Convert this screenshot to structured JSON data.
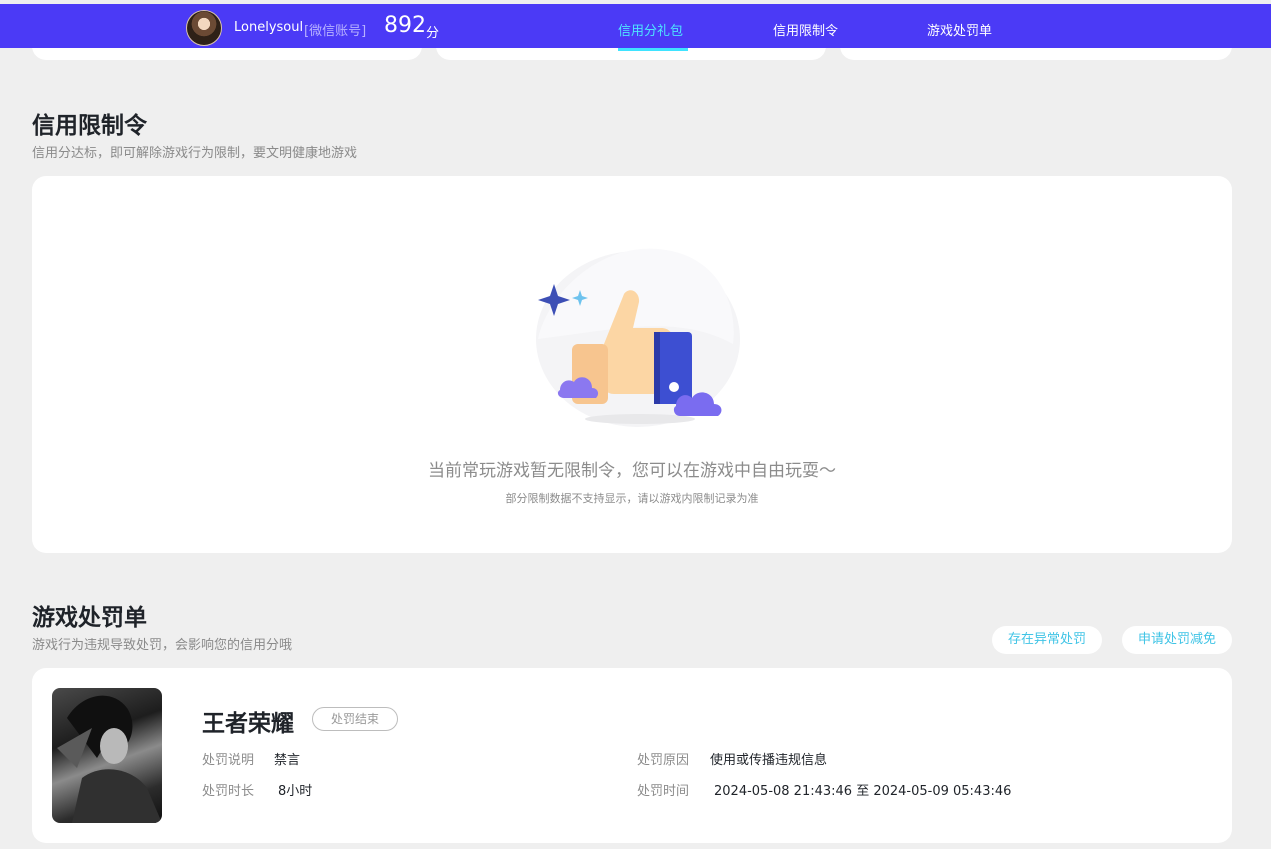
{
  "header": {
    "username": "Lonelysoul",
    "account_type": "[微信账号]",
    "score": "892",
    "score_unit": "分",
    "nav": [
      {
        "label": "信用分礼包",
        "active": true
      },
      {
        "label": "信用限制令",
        "active": false
      },
      {
        "label": "游戏处罚单",
        "active": false
      }
    ],
    "accent_color": "#4b3af6",
    "active_color": "#4fe6ff"
  },
  "restriction": {
    "title": "信用限制令",
    "subtitle": "信用分达标，即可解除游戏行为限制，要文明健康地游戏",
    "empty_message": "当前常玩游戏暂无限制令，您可以在游戏中自由玩耍～",
    "empty_note": "部分限制数据不支持显示，请以游戏内限制记录为准",
    "illustration_icon": "thumbs-up-icon"
  },
  "penalty": {
    "title": "游戏处罚单",
    "subtitle": "游戏行为违规导致处罚，会影响您的信用分哦",
    "actions": [
      "存在异常处罚",
      "申请处罚减免"
    ],
    "record": {
      "game": "王者荣耀",
      "status": "处罚结束",
      "fields": {
        "desc_label": "处罚说明",
        "desc_value": "禁言",
        "reason_label": "处罚原因",
        "reason_value": "使用或传播违规信息",
        "duration_label": "处罚时长",
        "duration_value": "8小时",
        "time_label": "处罚时间",
        "time_value": "2024-05-08 21:43:46 至 2024-05-09 05:43:46"
      }
    }
  }
}
